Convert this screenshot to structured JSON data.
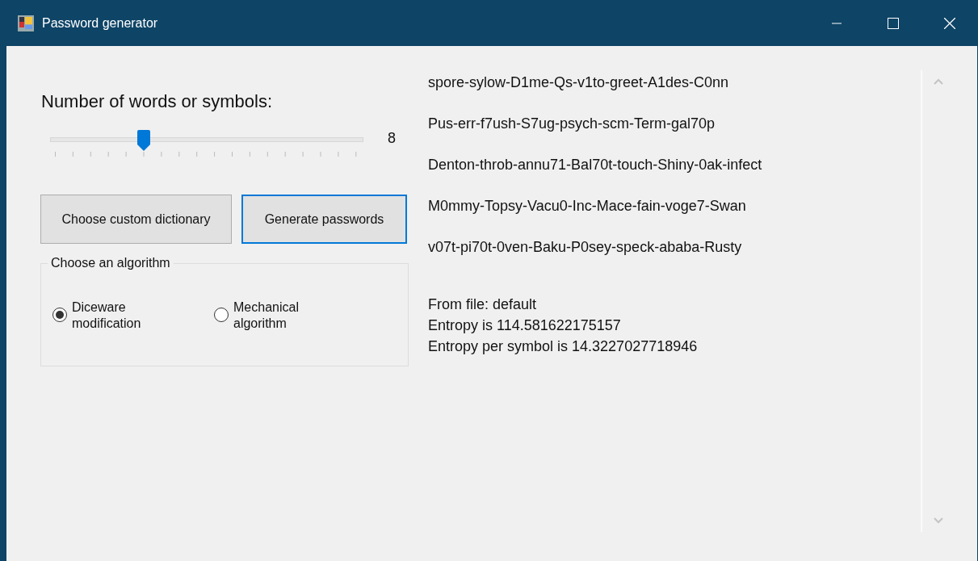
{
  "window": {
    "title": "Password generator"
  },
  "slider": {
    "label": "Number of words or symbols:",
    "level": 0.3,
    "reading": "8"
  },
  "buttons": [
    {
      "label": "Choose custom dictionary",
      "focused": false
    },
    {
      "label": "Generate passwords",
      "focused": true
    }
  ],
  "algorithm_group": {
    "title": "Choose an algorithm",
    "options": [
      {
        "label": "Diceware modification",
        "selected": true
      },
      {
        "label": "Mechanical algorithm",
        "selected": false
      }
    ]
  },
  "passwords": [
    "spore-sylow-D1me-Qs-v1to-greet-A1des-C0nn",
    "Pus-err-f7ush-S7ug-psych-scm-Term-gal70p",
    "Denton-throb-annu71-Bal70t-touch-Shiny-0ak-infect",
    "M0mmy-Topsy-Vacu0-Inc-Mace-fain-voge7-Swan",
    "v07t-pi70t-0ven-Baku-P0sey-speck-ababa-Rusty"
  ],
  "info_lines": [
    "From file: default",
    "Entropy is 114.581622175157",
    "Entropy per symbol is 14.3227027718946"
  ]
}
